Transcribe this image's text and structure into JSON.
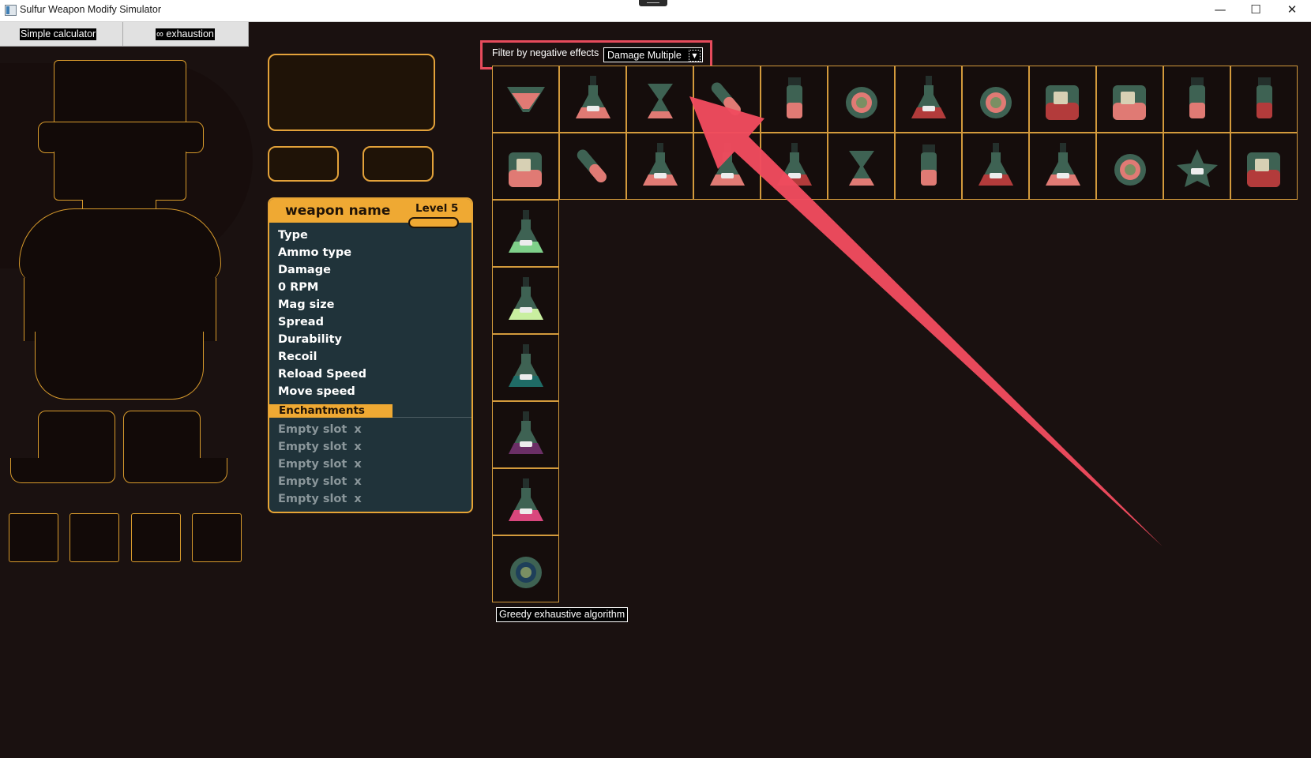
{
  "window": {
    "title": "Sulfur Weapon Modify Simulator",
    "controls": [
      "—",
      "☐",
      "✕"
    ]
  },
  "toolbar": {
    "simple_label": "Simple calculator",
    "exhaustion_label": "∞ exhaustion"
  },
  "weapon": {
    "name": "weapon name",
    "level": "Level 5",
    "stats": [
      "Type",
      "Ammo type",
      "Damage",
      "0 RPM",
      "Mag size",
      "Spread",
      "Durability",
      "Recoil",
      "Reload Speed",
      "Move speed"
    ],
    "enchantments_label": "Enchantments",
    "slots": [
      "Empty slot",
      "Empty slot",
      "Empty slot",
      "Empty slot",
      "Empty slot"
    ],
    "remove_symbol": "x"
  },
  "filter": {
    "label": "Filter by negative effects",
    "selected": "Damage Multiple"
  },
  "potions": {
    "row1": [
      "funnel",
      "bottle",
      "hourglass",
      "slanted-vial",
      "tall-vial",
      "round-flask",
      "dark-flask",
      "round-bottle",
      "dark-jug",
      "mug",
      "thin-vial",
      "tall-dark"
    ],
    "row2": [
      "jerrycan",
      "tube",
      "flask",
      "bottle",
      "dark-flask",
      "hourglass",
      "tall-vial",
      "dark-flask",
      "bottle",
      "round-flask",
      "star-flask",
      "dark-jug"
    ],
    "column": [
      "flask-green",
      "flask-lightgreen",
      "flask-teal",
      "flask-purple",
      "flask-pink",
      "round-blue"
    ]
  },
  "algorithm_button": "Greedy exhaustive algorithm",
  "colors": {
    "accent": "#efa933",
    "panel": "#20333a",
    "background": "#1a1110",
    "highlight": "#e64b5c"
  }
}
